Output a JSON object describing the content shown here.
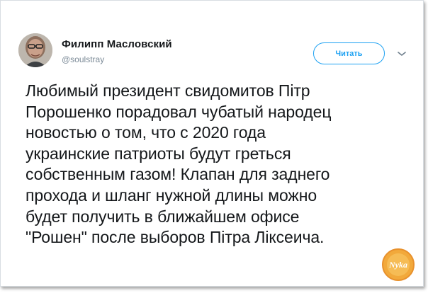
{
  "tweet": {
    "author": {
      "name": "Филипп Масловский",
      "handle": "@soulstray"
    },
    "follow_label": "Читать",
    "text": "Любимый президент свидомитов Пітр\nПорошенко порадовал чубатый народец\nновостью о том, что с 2020 года\nукраинские патриоты будут греться\nсобственным газом! Клапан для заднего\nпрохода и шланг нужной длины можно\nбудет получить в ближайшем офисе\n\"Рошен\" после выборов Пітра Ліксеича."
  },
  "watermark": {
    "text": "Nykа"
  },
  "colors": {
    "accent": "#1da1f2",
    "text": "#14171a",
    "muted": "#7b8a97",
    "watermark": "#f2a93b"
  },
  "icons": {
    "avatar": "avatar-photo",
    "menu": "chevron-down-icon",
    "watermark": "logo-badge-icon"
  }
}
